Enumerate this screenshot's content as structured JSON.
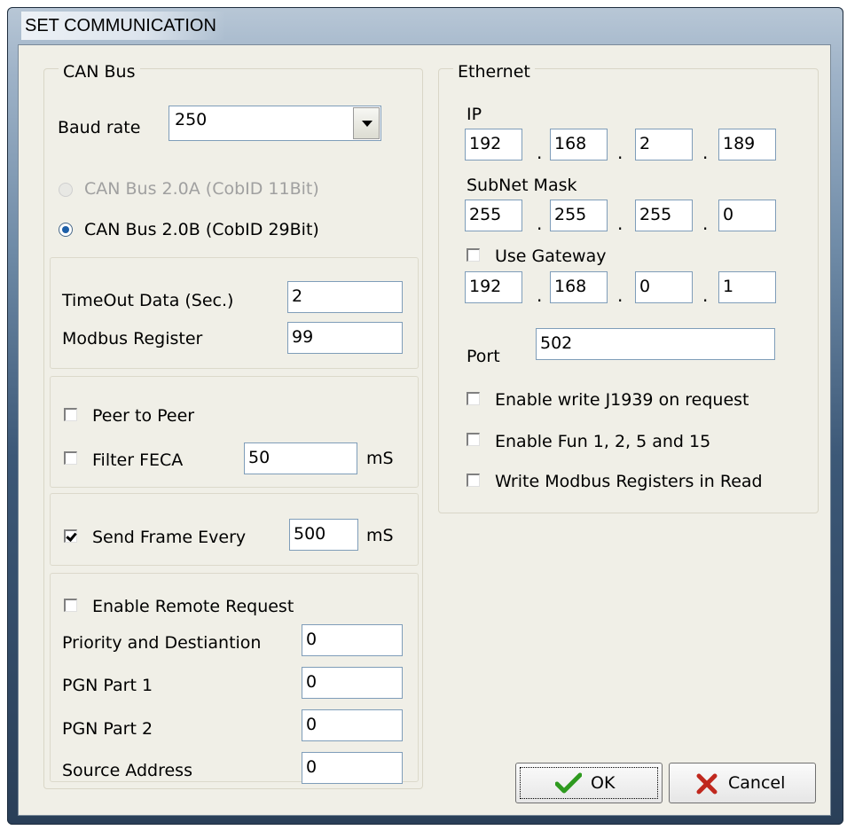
{
  "window": {
    "title": "SET COMMUNICATION"
  },
  "can_bus": {
    "legend": "CAN Bus",
    "baud_label": "Baud rate",
    "baud_value": "250",
    "radio_a": "CAN Bus 2.0A (CobID 11Bit)",
    "radio_b": "CAN Bus 2.0B (CobID 29Bit)",
    "timeout_label": "TimeOut Data  (Sec.)",
    "timeout_value": "2",
    "modbus_label": "Modbus Register",
    "modbus_value": "99",
    "peer_label": "Peer to Peer",
    "peer_checked": false,
    "filter_label": "Filter FECA",
    "filter_checked": false,
    "filter_value": "50",
    "filter_unit": "mS",
    "send_label": "Send Frame Every",
    "send_checked": true,
    "send_value": "500",
    "send_unit": "mS",
    "remote_label": "Enable Remote Request",
    "remote_checked": false,
    "priority_label": "Priority and Destiantion",
    "priority_value": "0",
    "pgn1_label": "PGN Part 1",
    "pgn1_value": "0",
    "pgn2_label": "PGN Part 2",
    "pgn2_value": "0",
    "source_label": "Source Address",
    "source_value": "0"
  },
  "ethernet": {
    "legend": "Ethernet",
    "ip_label": "IP",
    "ip": [
      "192",
      "168",
      "2",
      "189"
    ],
    "mask_label": "SubNet Mask",
    "mask": [
      "255",
      "255",
      "255",
      "0"
    ],
    "gateway_label": "Use Gateway",
    "gateway_checked": false,
    "gateway": [
      "192",
      "168",
      "0",
      "1"
    ],
    "port_label": "Port",
    "port_value": "502",
    "j1939_label": "Enable write J1939 on request",
    "fun_label": "Enable Fun 1, 2, 5 and 15",
    "write_label": "Write Modbus Registers in Read",
    "dot": "."
  },
  "buttons": {
    "ok": "OK",
    "cancel": "Cancel"
  },
  "icons": {
    "ok": "checkmark-icon",
    "cancel": "x-cross-icon"
  },
  "colors": {
    "ok_icon": "#2e9a1f",
    "cancel_icon": "#c0281e",
    "radio_dot": "#1d5fa8"
  }
}
